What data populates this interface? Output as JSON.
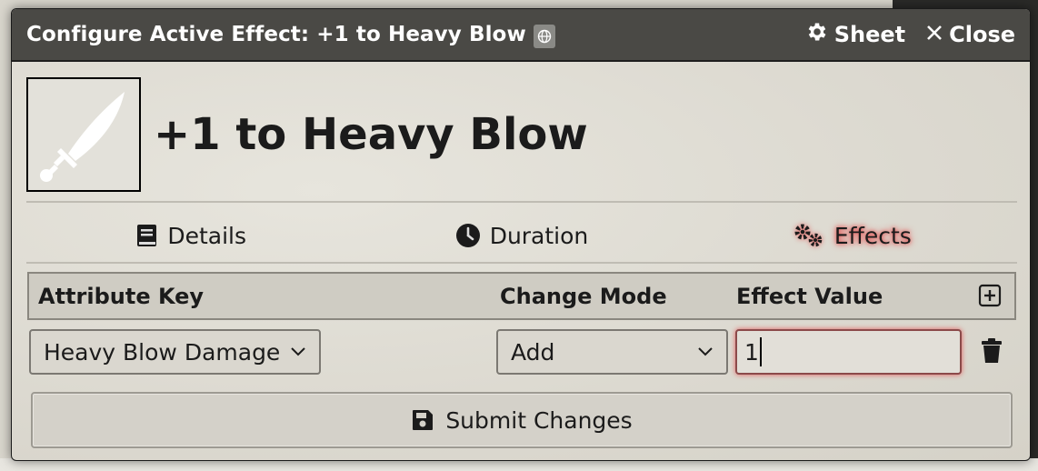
{
  "window": {
    "title": "Configure Active Effect: +1 to Heavy Blow",
    "title_icon": "globe-icon",
    "controls": [
      {
        "icon": "gear-icon",
        "label": "Sheet"
      },
      {
        "icon": "close-icon",
        "label": "Close"
      }
    ]
  },
  "effect": {
    "name": "+1 to Heavy Blow",
    "image_icon": "sword-icon"
  },
  "tabs": [
    {
      "icon": "book-icon",
      "label": "Details",
      "active": false
    },
    {
      "icon": "clock-icon",
      "label": "Duration",
      "active": false
    },
    {
      "icon": "gears-icon",
      "label": "Effects",
      "active": true
    }
  ],
  "table": {
    "headers": {
      "attribute_key": "Attribute Key",
      "change_mode": "Change Mode",
      "effect_value": "Effect Value"
    },
    "rows": [
      {
        "attribute_key": "Heavy Blow Damage",
        "change_mode": "Add",
        "effect_value": "1"
      }
    ]
  },
  "submit": {
    "label": "Submit Changes",
    "icon": "save-icon"
  },
  "colors": {
    "titlebar": "#4a4945",
    "active_tab_glow": "#e34b4b",
    "window_bg": "#e0ddd5"
  }
}
